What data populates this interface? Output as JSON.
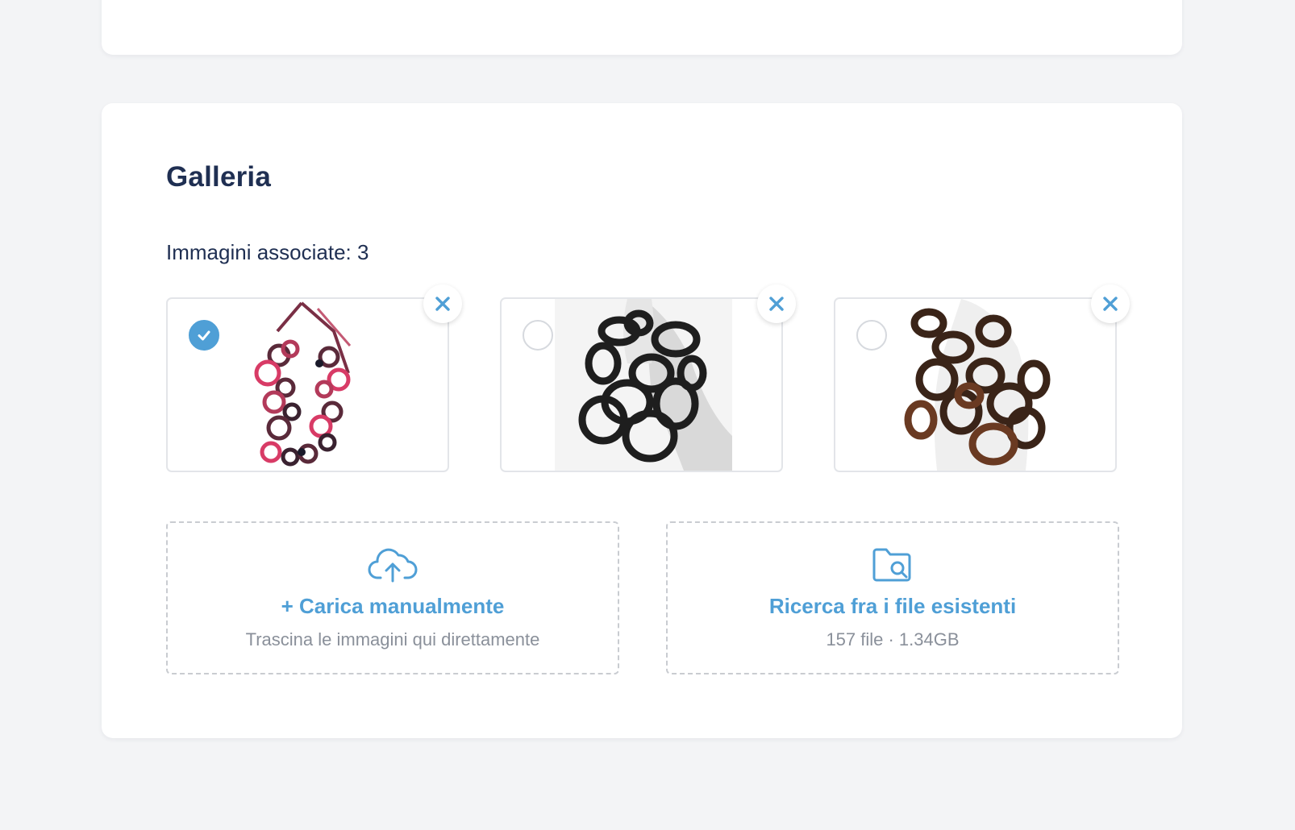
{
  "gallery": {
    "title": "Galleria",
    "count_label": "Immagini associate: 3",
    "images": [
      {
        "name": "necklace-red",
        "selected": true
      },
      {
        "name": "necklace-black",
        "selected": false
      },
      {
        "name": "necklace-brown",
        "selected": false
      }
    ],
    "upload": {
      "label": "+ Carica manualmente",
      "hint": "Trascina le immagini qui direttamente",
      "icon": "cloud-upload-icon"
    },
    "browse": {
      "label": "Ricerca fra i file esistenti",
      "hint": "157 file · 1.34GB",
      "icon": "folder-search-icon"
    }
  },
  "colors": {
    "accent": "#4f9fd6",
    "heading": "#1f2f52",
    "muted": "#8a909a",
    "background": "#f3f4f6"
  }
}
